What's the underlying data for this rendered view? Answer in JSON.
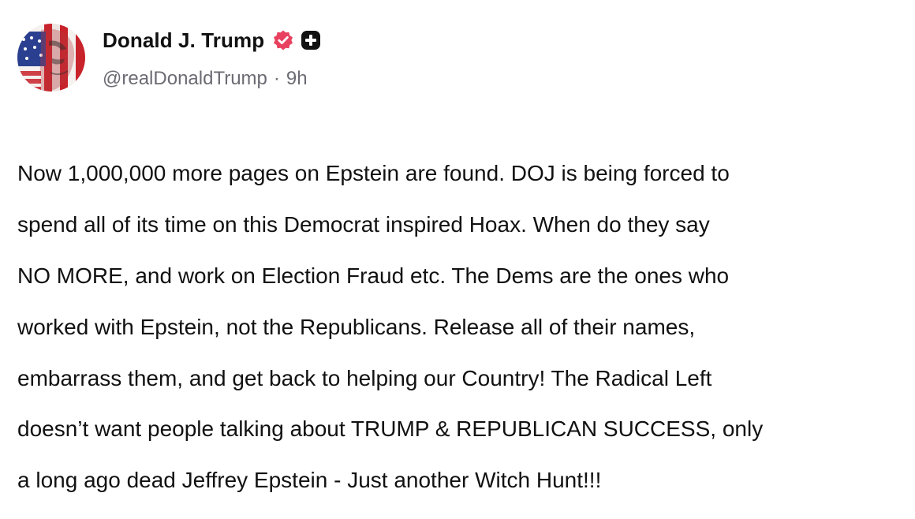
{
  "author": {
    "display_name": "Donald J. Trump",
    "handle": "@realDonaldTrump",
    "separator": "·",
    "time_ago": "9h",
    "verified": true,
    "badge_color": "#e8415f",
    "plus_badge_color": "#111111"
  },
  "post": {
    "lines": [
      "Now 1,000,000 more pages on Epstein are found. DOJ is being forced to",
      "spend all of its time on this Democrat inspired Hoax. When do they say",
      "NO MORE, and work on Election Fraud etc. The Dems are the ones who",
      "worked with Epstein, not the Republicans. Release all of their names,",
      "embarrass them, and get back to helping our Country! The Radical Left",
      "doesn’t want people talking about TRUMP & REPUBLICAN SUCCESS, only",
      "a long ago dead Jeffrey Epstein - Just another Witch Hunt!!!"
    ]
  },
  "icons": {
    "avatar": "avatar-flag-portrait",
    "verified": "verified-badge-icon",
    "plus": "plus-badge-icon"
  }
}
